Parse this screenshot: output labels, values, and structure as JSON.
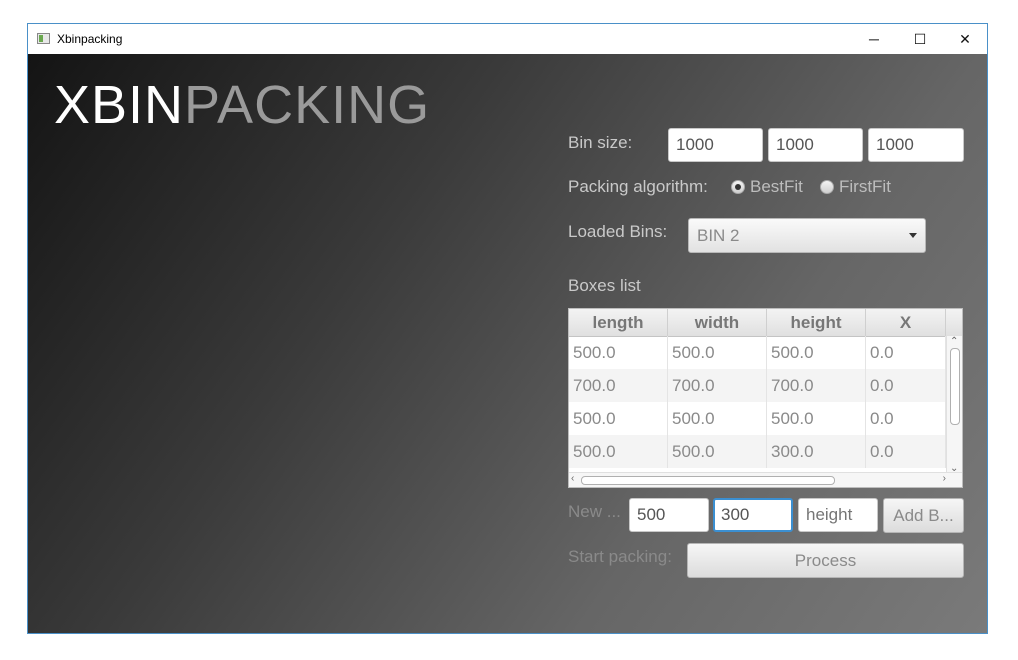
{
  "window": {
    "title": "Xbinpacking",
    "minimize": "─",
    "maximize": "☐",
    "close": "✕"
  },
  "logo": {
    "part1": "XBIN",
    "part2": "PACKING"
  },
  "bin_size": {
    "label": "Bin size:",
    "values": [
      "1000",
      "1000",
      "1000"
    ]
  },
  "algorithm": {
    "label": "Packing algorithm:",
    "options": [
      "BestFit",
      "FirstFit"
    ],
    "selected": "BestFit"
  },
  "loaded_bins": {
    "label": "Loaded Bins:",
    "selected": "BIN 2"
  },
  "boxes": {
    "label": "Boxes list",
    "columns": [
      "length",
      "width",
      "height",
      "X"
    ],
    "rows": [
      [
        "500.0",
        "500.0",
        "500.0",
        "0.0"
      ],
      [
        "700.0",
        "700.0",
        "700.0",
        "0.0"
      ],
      [
        "500.0",
        "500.0",
        "500.0",
        "0.0"
      ],
      [
        "500.0",
        "500.0",
        "300.0",
        "0.0"
      ]
    ]
  },
  "new_box": {
    "label": "New ...",
    "length_value": "500",
    "width_value": "300",
    "height_placeholder": "height",
    "add_button": "Add B..."
  },
  "start": {
    "label": "Start packing:",
    "process_button": "Process"
  }
}
